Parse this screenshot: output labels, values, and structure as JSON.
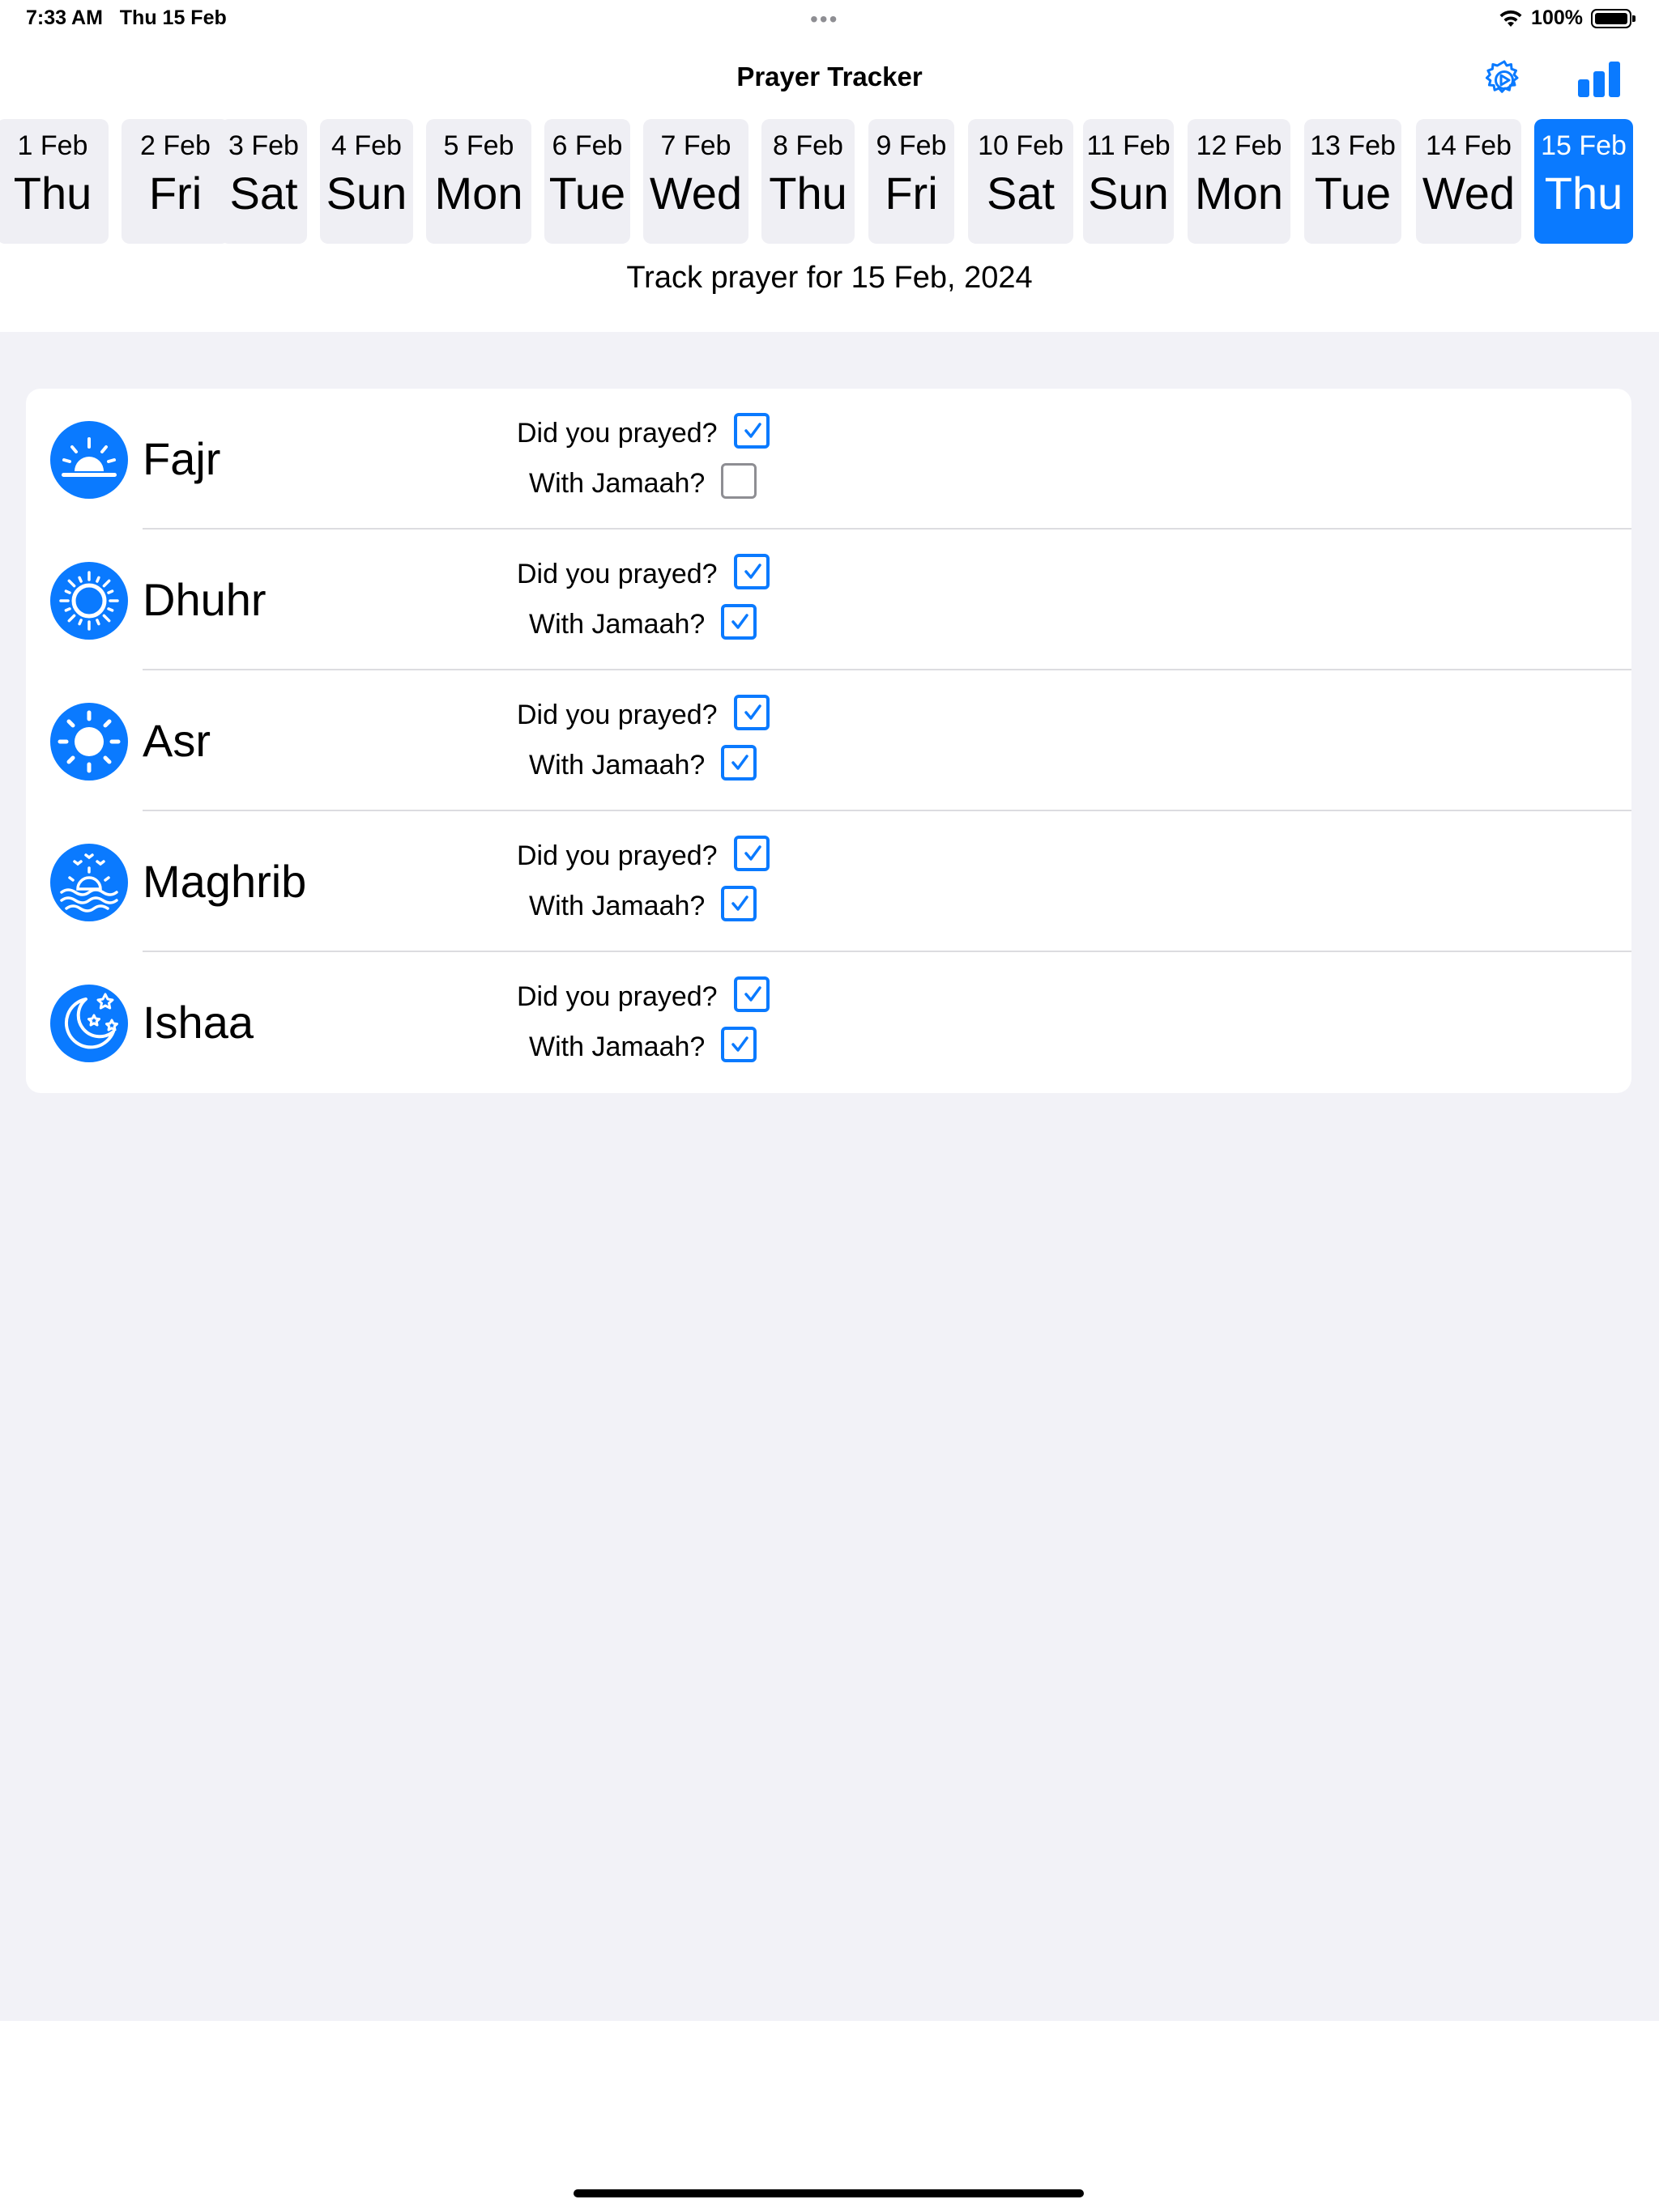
{
  "status_bar": {
    "time": "7:33 AM",
    "date": "Thu 15 Feb",
    "battery": "100%",
    "battery_level": 1.0
  },
  "nav": {
    "title": "Prayer Tracker",
    "settings_icon": "gear-play-icon",
    "stats_icon": "bar-chart-icon"
  },
  "days": [
    {
      "date": "1 Feb",
      "day": "Thu",
      "selected": false
    },
    {
      "date": "2 Feb",
      "day": "Fri",
      "selected": false
    },
    {
      "date": "3 Feb",
      "day": "Sat",
      "selected": false
    },
    {
      "date": "4 Feb",
      "day": "Sun",
      "selected": false
    },
    {
      "date": "5 Feb",
      "day": "Mon",
      "selected": false
    },
    {
      "date": "6 Feb",
      "day": "Tue",
      "selected": false
    },
    {
      "date": "7 Feb",
      "day": "Wed",
      "selected": false
    },
    {
      "date": "8 Feb",
      "day": "Thu",
      "selected": false
    },
    {
      "date": "9 Feb",
      "day": "Fri",
      "selected": false
    },
    {
      "date": "10 Feb",
      "day": "Sat",
      "selected": false
    },
    {
      "date": "11 Feb",
      "day": "Sun",
      "selected": false
    },
    {
      "date": "12 Feb",
      "day": "Mon",
      "selected": false
    },
    {
      "date": "13 Feb",
      "day": "Tue",
      "selected": false
    },
    {
      "date": "14 Feb",
      "day": "Wed",
      "selected": false
    },
    {
      "date": "15 Feb",
      "day": "Thu",
      "selected": true
    }
  ],
  "track_label": "Track prayer for 15 Feb, 2024",
  "questions": {
    "prayed": "Did you prayed?",
    "jamaah": "With Jamaah?"
  },
  "prayers": [
    {
      "name": "Fajr",
      "icon": "sunrise-icon",
      "prayed": true,
      "jamaah": false
    },
    {
      "name": "Dhuhr",
      "icon": "sun-rays-icon",
      "prayed": true,
      "jamaah": true
    },
    {
      "name": "Asr",
      "icon": "sun-icon",
      "prayed": true,
      "jamaah": true
    },
    {
      "name": "Maghrib",
      "icon": "sunset-sea-icon",
      "prayed": true,
      "jamaah": true
    },
    {
      "name": "Ishaa",
      "icon": "moon-stars-icon",
      "prayed": true,
      "jamaah": true
    }
  ],
  "colors": {
    "accent": "#0a7aff",
    "grouped_background": "#f2f2f7",
    "chip_background": "#efeff4"
  }
}
